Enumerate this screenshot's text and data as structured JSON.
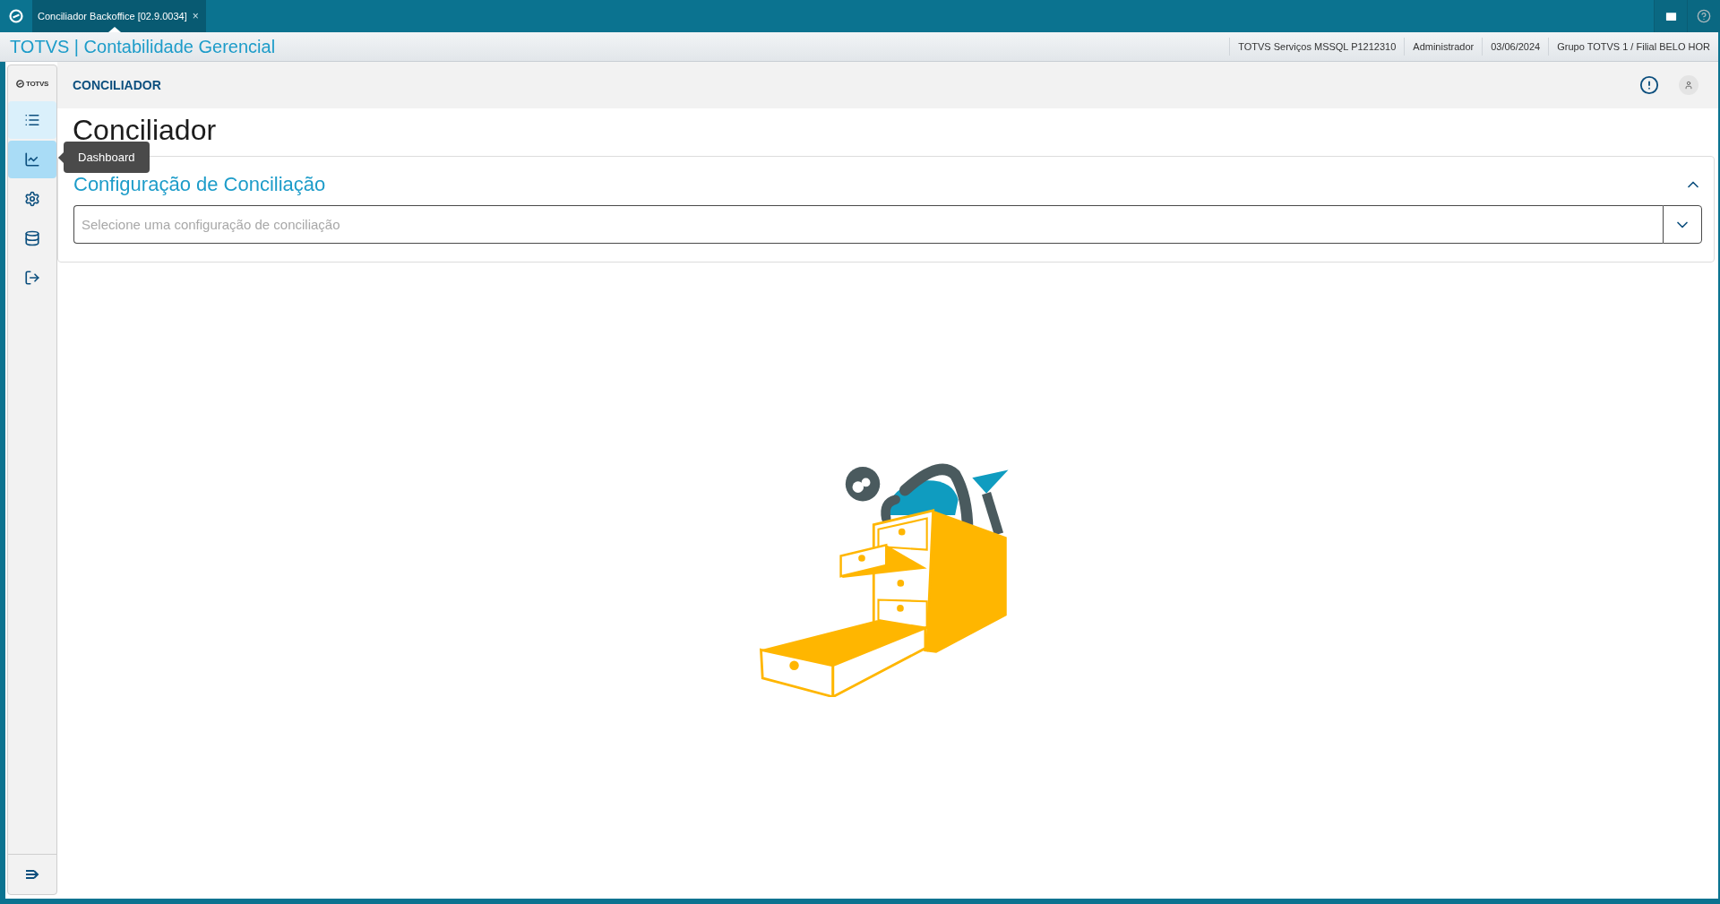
{
  "window": {
    "tab": {
      "title": "Conciliador Backoffice [02.9.0034]",
      "close": "×",
      "selected": true
    }
  },
  "app_bar": {
    "title": "TOTVS | Contabilidade Gerencial",
    "info": [
      "TOTVS Serviços MSSQL P1212310",
      "Administrador",
      "03/06/2024",
      "Grupo TOTVS 1 / Filial BELO HOR"
    ]
  },
  "sidebar": {
    "logo": "TOTVS",
    "items": [
      {
        "kind": "list",
        "selected": true,
        "hovered": false
      },
      {
        "kind": "chart",
        "selected": false,
        "hovered": true
      },
      {
        "kind": "settings",
        "selected": false,
        "hovered": false
      },
      {
        "kind": "database",
        "selected": false,
        "hovered": false
      },
      {
        "kind": "logout",
        "selected": false,
        "hovered": false
      }
    ],
    "tooltip": "Dashboard"
  },
  "header": {
    "title": "CONCILIADOR"
  },
  "page": {
    "title": "Conciliador",
    "section": {
      "title": "Configuração de Conciliação",
      "expanded": true,
      "select": {
        "placeholder": "Selecione uma configuração de conciliação"
      }
    }
  }
}
